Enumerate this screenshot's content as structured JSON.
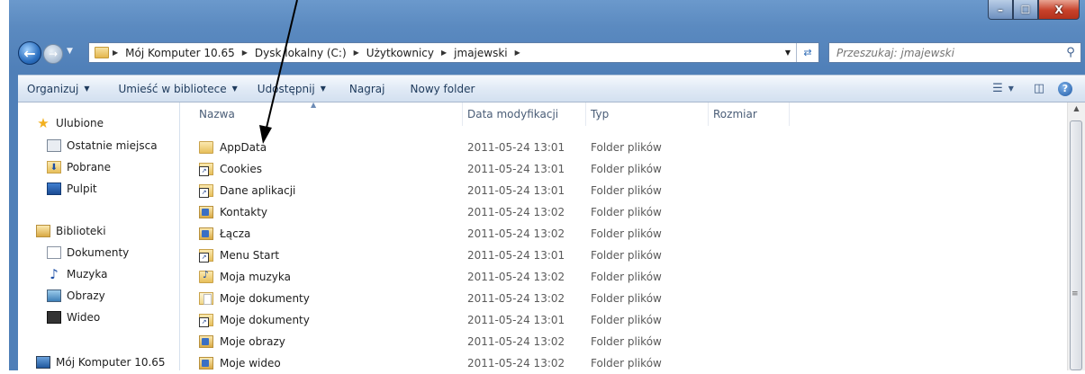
{
  "window": {
    "min_label": "–",
    "max_label": "☐",
    "close_label": "X"
  },
  "address": {
    "crumbs": [
      "Mój Komputer 10.65",
      "Dysk lokalny (C:)",
      "Użytkownicy",
      "jmajewski"
    ],
    "search_placeholder": "Przeszukaj: jmajewski"
  },
  "toolbar": {
    "organize": "Organizuj",
    "library": "Umieść w bibliotece",
    "share": "Udostępnij",
    "burn": "Nagraj",
    "new_folder": "Nowy folder"
  },
  "nav": {
    "favorites": "Ulubione",
    "recent": "Ostatnie miejsca",
    "downloads": "Pobrane",
    "desktop": "Pulpit",
    "libraries": "Biblioteki",
    "documents": "Dokumenty",
    "music": "Muzyka",
    "pictures": "Obrazy",
    "videos": "Wideo",
    "computer": "Mój Komputer 10.65"
  },
  "columns": {
    "name": "Nazwa",
    "date": "Data modyfikacji",
    "type": "Typ",
    "size": "Rozmiar"
  },
  "files": [
    {
      "name": "AppData",
      "date": "2011-05-24 13:01",
      "type": "Folder plików",
      "icon": "folder-icon"
    },
    {
      "name": "Cookies",
      "date": "2011-05-24 13:01",
      "type": "Folder plików",
      "icon": "shortcut-folder-icon"
    },
    {
      "name": "Dane aplikacji",
      "date": "2011-05-24 13:01",
      "type": "Folder plików",
      "icon": "shortcut-folder-icon"
    },
    {
      "name": "Kontakty",
      "date": "2011-05-24 13:02",
      "type": "Folder plików",
      "icon": "contacts-folder-icon"
    },
    {
      "name": "Łącza",
      "date": "2011-05-24 13:02",
      "type": "Folder plików",
      "icon": "links-folder-icon"
    },
    {
      "name": "Menu Start",
      "date": "2011-05-24 13:01",
      "type": "Folder plików",
      "icon": "shortcut-folder-icon"
    },
    {
      "name": "Moja muzyka",
      "date": "2011-05-24 13:02",
      "type": "Folder plików",
      "icon": "music-folder-icon"
    },
    {
      "name": "Moje dokumenty",
      "date": "2011-05-24 13:02",
      "type": "Folder plików",
      "icon": "documents-folder-icon"
    },
    {
      "name": "Moje dokumenty",
      "date": "2011-05-24 13:01",
      "type": "Folder plików",
      "icon": "shortcut-folder-icon"
    },
    {
      "name": "Moje obrazy",
      "date": "2011-05-24 13:02",
      "type": "Folder plików",
      "icon": "pictures-folder-icon"
    },
    {
      "name": "Moje wideo",
      "date": "2011-05-24 13:02",
      "type": "Folder plików",
      "icon": "video-folder-icon"
    }
  ]
}
